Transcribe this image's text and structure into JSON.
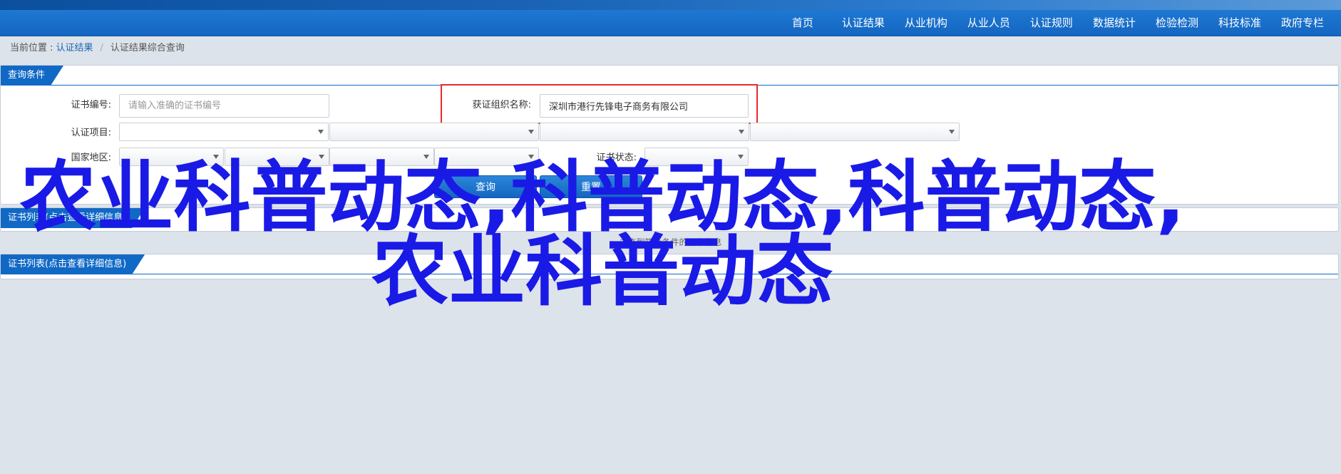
{
  "nav": {
    "items": [
      "首页",
      "认证结果",
      "从业机构",
      "从业人员",
      "认证规则",
      "数据统计",
      "检验检测",
      "科技标准",
      "政府专栏"
    ]
  },
  "breadcrumb": {
    "prefix": "当前位置 :",
    "link": "认证结果",
    "separator": "/",
    "current": "认证结果综合查询"
  },
  "query_panel": {
    "title": "查询条件",
    "cert_no_label": "证书编号:",
    "cert_no_placeholder": "请输入准确的证书编号",
    "org_label": "获证组织名称:",
    "org_value": "深圳市港行先锋电子商务有限公司",
    "project_label": "认证项目:",
    "region_label": "国家地区:",
    "status_label": "证书状态:",
    "query_button": "查询",
    "reset_button": "重置"
  },
  "result_panel": {
    "title": "证书列表(点击查看详细信息)",
    "empty_text": "未查到符合条件的证书信息"
  },
  "cert_panel": {
    "title": "证书列表(点击查看详细信息)"
  },
  "overlay": {
    "text": "农业科普动态,科普动态,科普动态,农业科普动态"
  },
  "colors": {
    "nav_blue": "#1466c1",
    "panel_head_blue": "#1169c6",
    "highlight_red": "#e8282b",
    "overlay_blue": "#1a1ae6"
  }
}
